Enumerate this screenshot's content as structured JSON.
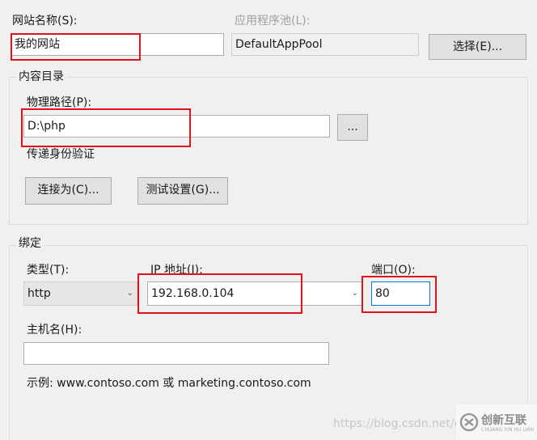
{
  "site": {
    "name_label": "网站名称(S):",
    "name_value": "我的网站",
    "pool_label": "应用程序池(L):",
    "pool_value": "DefaultAppPool",
    "select_button": "选择(E)..."
  },
  "content": {
    "group_title": "内容目录",
    "path_label": "物理路径(P):",
    "path_value": "D:\\php",
    "browse_button": "...",
    "auth_label": "传递身份验证",
    "connect_button": "连接为(C)...",
    "test_button": "测试设置(G)..."
  },
  "binding": {
    "group_title": "绑定",
    "type_label": "类型(T):",
    "type_value": "http",
    "ip_label": "IP 地址(I):",
    "ip_value": "192.168.0.104",
    "port_label": "端口(O):",
    "port_value": "80",
    "host_label": "主机名(H):",
    "host_value": "",
    "example": "示例: www.contoso.com 或 marketing.contoso.com"
  },
  "watermark": {
    "url": "https://blog.csdn.net/q",
    "brand": "创新互联",
    "brand_sub": "CHUANG XIN HU LIAN"
  },
  "colors": {
    "highlight": "#e0121d",
    "focus_border": "#0078d7"
  }
}
